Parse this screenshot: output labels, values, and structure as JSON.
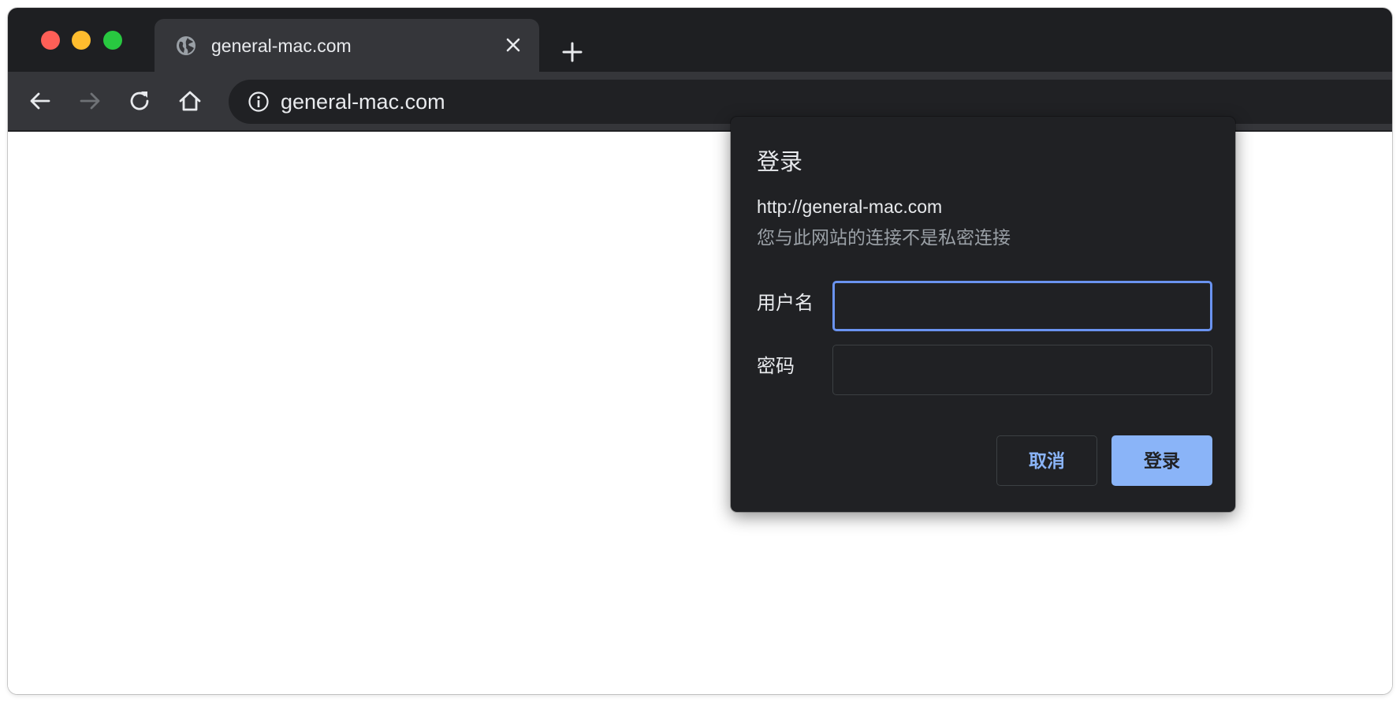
{
  "window": {
    "traffic_lights": [
      "close",
      "minimize",
      "zoom"
    ]
  },
  "tab": {
    "title": "general-mac.com",
    "favicon": "globe-icon",
    "close_icon": "close-icon"
  },
  "new_tab_icon": "plus-icon",
  "toolbar": {
    "back_icon": "arrow-left-icon",
    "forward_icon": "arrow-right-icon",
    "reload_icon": "reload-icon",
    "home_icon": "home-icon",
    "site_info_icon": "info-icon",
    "address": "general-mac.com"
  },
  "dialog": {
    "title": "登录",
    "url": "http://general-mac.com",
    "warning": "您与此网站的连接不是私密连接",
    "username_label": "用户名",
    "username_value": "",
    "password_label": "密码",
    "password_value": "",
    "cancel_label": "取消",
    "submit_label": "登录"
  },
  "colors": {
    "accent": "#8ab4f8",
    "focus_ring": "#6a93f0",
    "dialog_bg": "#202124",
    "toolbar_bg": "#35363a",
    "tabstrip_bg": "#1e1f22"
  }
}
